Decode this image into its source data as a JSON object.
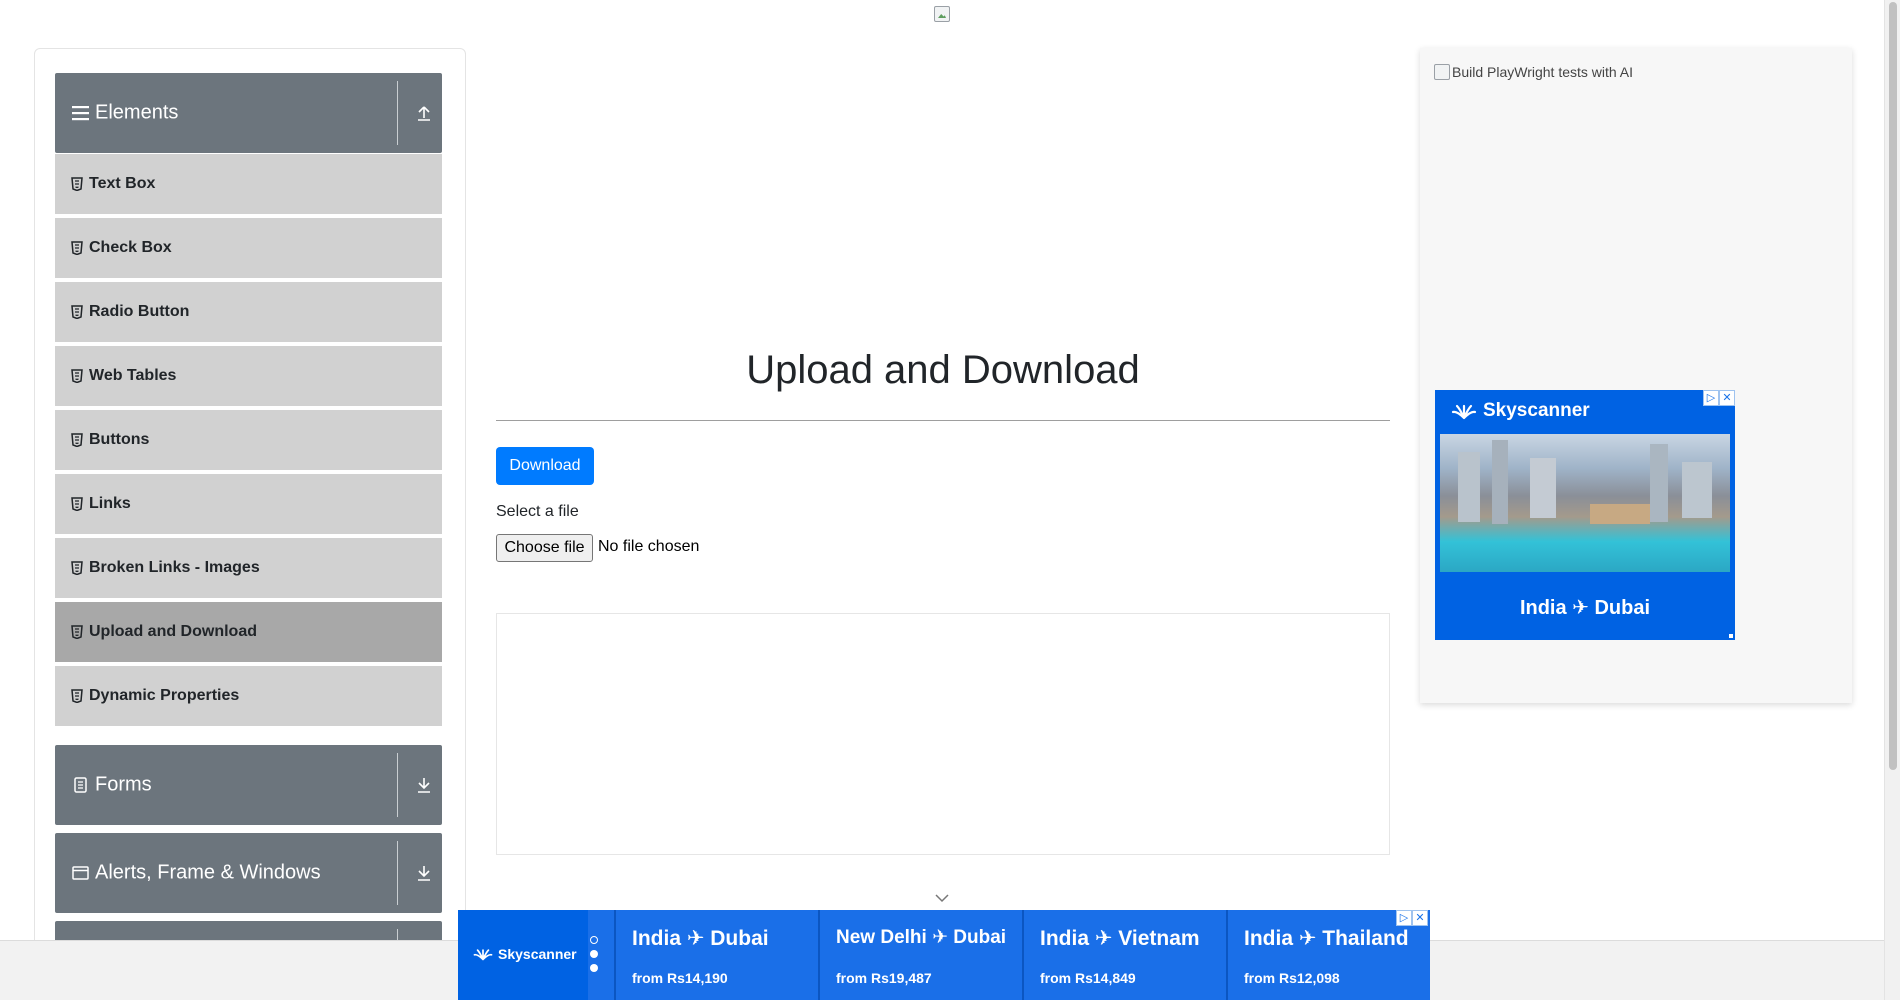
{
  "sidebar": {
    "elements_group": {
      "title": "Elements",
      "expanded": true
    },
    "items": [
      {
        "label": "Text Box"
      },
      {
        "label": "Check Box"
      },
      {
        "label": "Radio Button"
      },
      {
        "label": "Web Tables"
      },
      {
        "label": "Buttons"
      },
      {
        "label": "Links"
      },
      {
        "label": "Broken Links - Images"
      },
      {
        "label": "Upload and Download",
        "active": true
      },
      {
        "label": "Dynamic Properties"
      }
    ],
    "forms_group": {
      "title": "Forms"
    },
    "alerts_group": {
      "title": "Alerts, Frame & Windows"
    }
  },
  "main": {
    "title": "Upload and Download",
    "download_label": "Download",
    "select_label": "Select a file",
    "choose_file_label": "Choose file",
    "file_status": "No file chosen"
  },
  "right_ad": {
    "broken_image_alt": "Build PlayWright tests with AI",
    "brand": "Skyscanner",
    "route": "India ✈ Dubai"
  },
  "bottom_ad": {
    "brand": "Skyscanner",
    "deals": [
      {
        "route": "India ✈ Dubai",
        "price": "from Rs14,190"
      },
      {
        "route": "New Delhi ✈ Dubai",
        "price": "from Rs19,487"
      },
      {
        "route": "India ✈ Vietnam",
        "price": "from Rs14,849"
      },
      {
        "route": "India ✈ Thailand",
        "price": "from Rs12,098"
      }
    ]
  },
  "colors": {
    "primary": "#007bff",
    "sidebar_header": "#6c757d",
    "menu_item": "#d1d1d1",
    "menu_item_active": "#a8a8a8",
    "skyscanner_blue": "#0062e3"
  }
}
